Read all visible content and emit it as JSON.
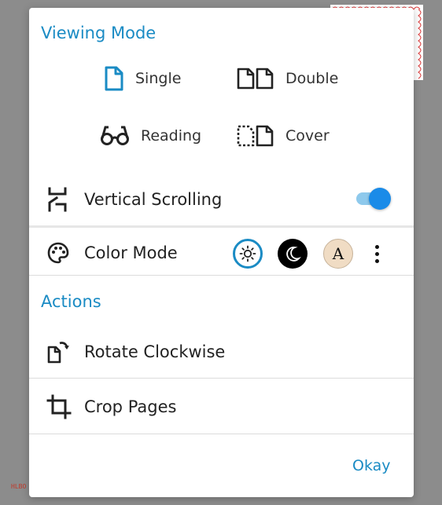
{
  "background": {
    "stamp_text": "HLBO"
  },
  "viewing_mode": {
    "title": "Viewing Mode",
    "options": [
      {
        "label": "Single",
        "icon": "single-page-icon",
        "selected": true
      },
      {
        "label": "Double",
        "icon": "double-page-icon",
        "selected": false
      },
      {
        "label": "Reading",
        "icon": "reading-glasses-icon",
        "selected": false
      },
      {
        "label": "Cover",
        "icon": "cover-page-icon",
        "selected": false
      }
    ]
  },
  "vertical_scrolling": {
    "label": "Vertical Scrolling",
    "enabled": true
  },
  "color_mode": {
    "label": "Color Mode",
    "options": [
      "light",
      "dark",
      "sepia"
    ],
    "selected": "light",
    "sepia_letter": "A"
  },
  "actions": {
    "title": "Actions",
    "items": [
      {
        "label": "Rotate Clockwise",
        "icon": "rotate-clockwise-icon"
      },
      {
        "label": "Crop Pages",
        "icon": "crop-icon"
      }
    ]
  },
  "footer": {
    "okay_label": "Okay"
  },
  "colors": {
    "accent": "#1a8bc4",
    "toggle_on": "#1a8be8"
  }
}
